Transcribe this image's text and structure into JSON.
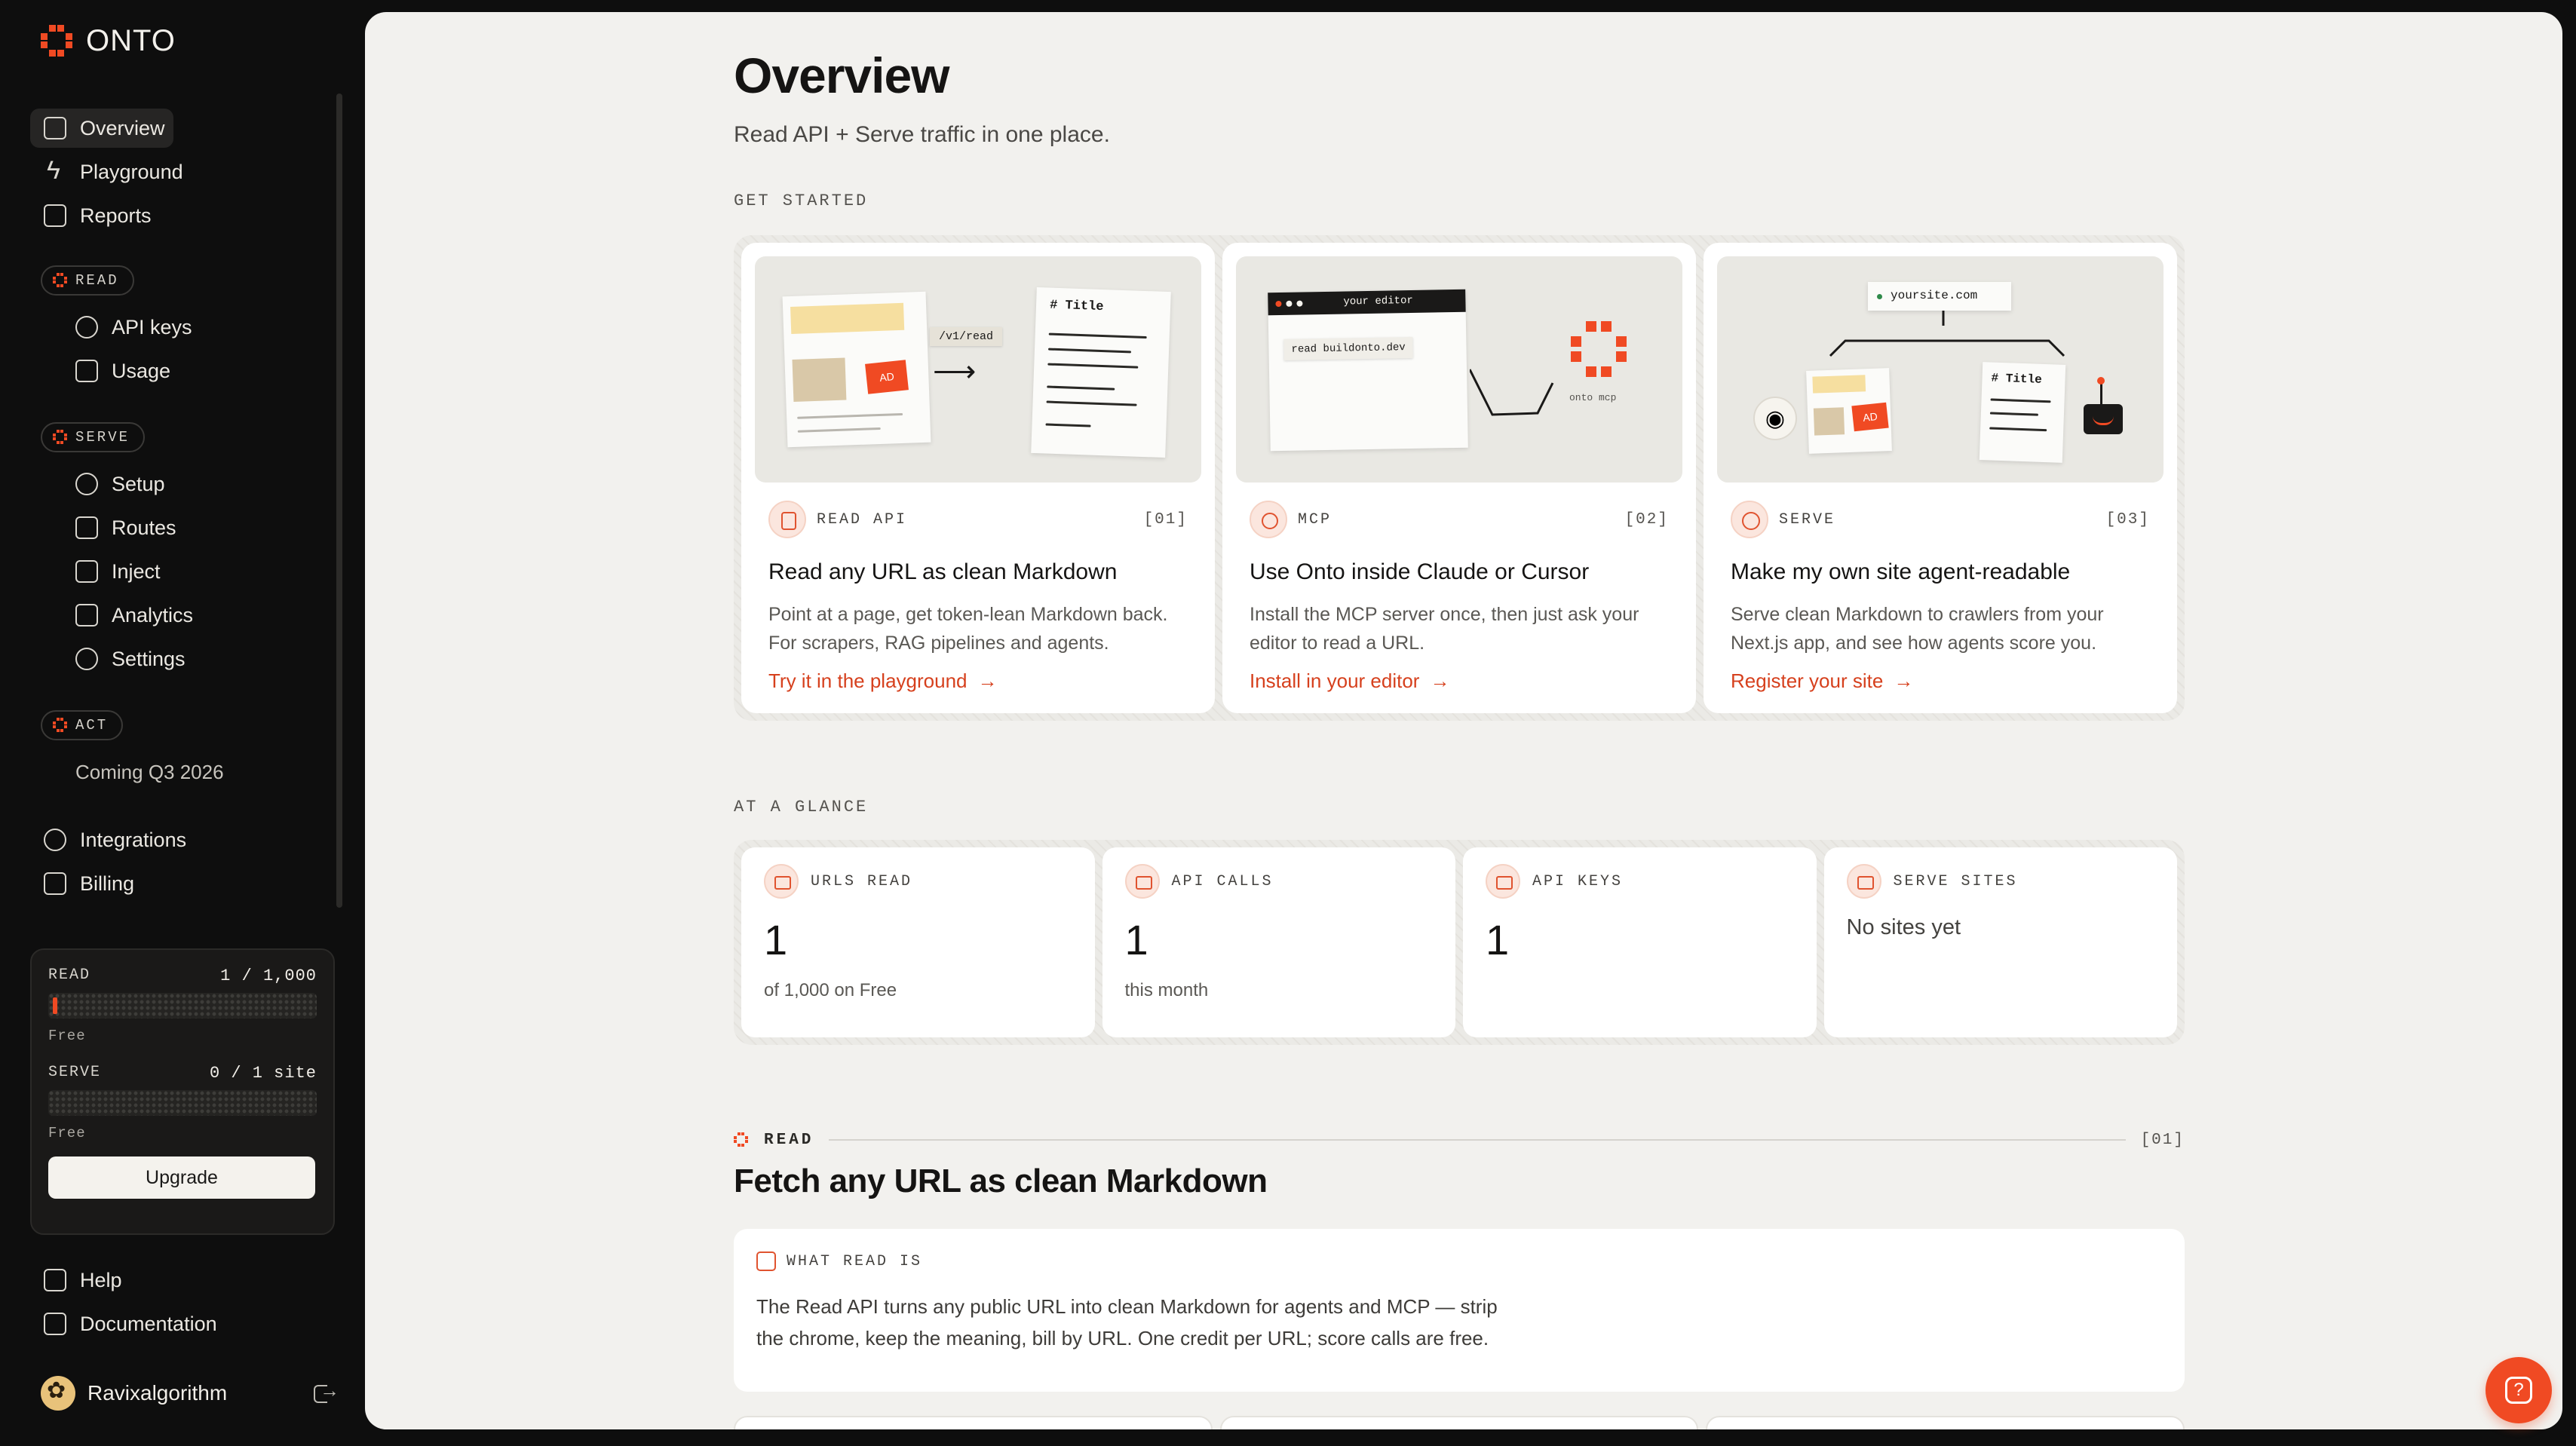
{
  "brand": {
    "name": "ONTO",
    "accent": "#f04a23"
  },
  "nav": {
    "top": [
      {
        "label": "Overview",
        "icon": "document-icon",
        "active": true
      },
      {
        "label": "Playground",
        "icon": "bolt-icon"
      },
      {
        "label": "Reports",
        "icon": "report-icon"
      }
    ],
    "read": {
      "section": "READ",
      "items": [
        {
          "label": "API keys",
          "icon": "key-icon"
        },
        {
          "label": "Usage",
          "icon": "chart-icon"
        }
      ]
    },
    "serve": {
      "section": "SERVE",
      "items": [
        {
          "label": "Setup",
          "icon": "sparkle-icon"
        },
        {
          "label": "Routes",
          "icon": "routes-icon"
        },
        {
          "label": "Inject",
          "icon": "inject-icon"
        },
        {
          "label": "Analytics",
          "icon": "bar-chart-icon"
        },
        {
          "label": "Settings",
          "icon": "gear-icon"
        }
      ]
    },
    "act": {
      "section": "ACT",
      "note": "Coming Q3 2026"
    },
    "misc": [
      {
        "label": "Integrations",
        "icon": "link-icon"
      },
      {
        "label": "Billing",
        "icon": "card-icon"
      }
    ],
    "bottom": [
      {
        "label": "Help",
        "icon": "help-icon"
      },
      {
        "label": "Documentation",
        "icon": "book-icon"
      }
    ]
  },
  "usage": {
    "read": {
      "label": "READ",
      "value": "1 / 1,000",
      "plan": "Free",
      "fraction": 0.001
    },
    "serve": {
      "label": "SERVE",
      "value": "0 / 1 site",
      "plan": "Free",
      "fraction": 0
    },
    "upgrade_label": "Upgrade"
  },
  "user": {
    "name": "Ravixalgorithm"
  },
  "page": {
    "title": "Overview",
    "subtitle": "Read API + Serve traffic in one place."
  },
  "get_started": {
    "eyebrow": "GET STARTED",
    "cards": [
      {
        "kicker": "READ API",
        "num": "[01]",
        "title": "Read any URL as clean Markdown",
        "desc": "Point at a page, get token-lean Markdown back. For scrapers, RAG pipelines and agents.",
        "link": "Try it in the playground",
        "illus": {
          "endpoint": "/v1/read",
          "heading": "# Title",
          "ad": "AD"
        }
      },
      {
        "kicker": "MCP",
        "num": "[02]",
        "title": "Use Onto inside Claude or Cursor",
        "desc": "Install the MCP server once, then just ask your editor to read a URL.",
        "link": "Install in your editor",
        "illus": {
          "window": "your editor",
          "command": "read buildonto.dev",
          "caption": "onto mcp"
        }
      },
      {
        "kicker": "SERVE",
        "num": "[03]",
        "title": "Make my own site agent-readable",
        "desc": "Serve clean Markdown to crawlers from your Next.js app, and see how agents score you.",
        "link": "Register your site",
        "illus": {
          "domain": "yoursite.com",
          "heading": "# Title",
          "ad": "AD"
        }
      }
    ]
  },
  "glance": {
    "eyebrow": "AT A GLANCE",
    "cards": [
      {
        "label": "URLS READ",
        "value": "1",
        "note": "of 1,000 on Free"
      },
      {
        "label": "API CALLS",
        "value": "1",
        "note": "this month"
      },
      {
        "label": "API KEYS",
        "value": "1",
        "note": ""
      },
      {
        "label": "SERVE SITES",
        "value": "",
        "note": "No sites yet"
      }
    ]
  },
  "read_section": {
    "label": "READ",
    "num": "[01]",
    "title": "Fetch any URL as clean Markdown",
    "what": {
      "label": "WHAT READ IS",
      "text": "The Read API turns any public URL into clean Markdown for agents and MCP — strip the chrome, keep the meaning, bill by URL. One credit per URL; score calls are free."
    }
  }
}
